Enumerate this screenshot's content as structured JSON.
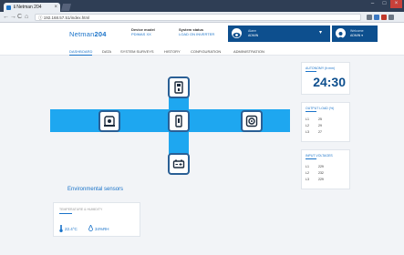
{
  "browser": {
    "tab_title": "ℹ Netman 204",
    "tab_close": "×",
    "url": "ⓘ 192.168.57.51/index.html",
    "nav": {
      "back": "←",
      "forward": "→",
      "reload": "C",
      "home": "⌂"
    },
    "window": {
      "minimize": "–",
      "maximize": "□",
      "close": "×"
    }
  },
  "header": {
    "logo_prefix": "Netman",
    "logo_suffix": "204",
    "device_model_label": "Device model",
    "device_model_value": "PDIMAS XX",
    "system_status_label": "System status",
    "system_status_value": "LOAD ON INVERTER",
    "user_name": "ADMIN",
    "user_caption": "Alarm",
    "welcome_label": "Welcome",
    "welcome_user": "ADMIN ▾",
    "caret": "▾"
  },
  "menu": [
    "DASHBOARD",
    "DATA",
    "SYSTEM SURVEYS",
    "HISTORY",
    "CONFIGURATION",
    "ADMINISTRATION"
  ],
  "cards": {
    "autonomy": {
      "title": "AUTONOMY (h:mm)",
      "value": "24:30"
    },
    "output": {
      "title": "OUTPUT LOAD (%)",
      "rows": [
        [
          "L1",
          "25"
        ],
        [
          "L2",
          "29"
        ],
        [
          "L3",
          "27"
        ]
      ]
    },
    "input": {
      "title": "INPUT VOLTAGES",
      "rows": [
        [
          "L1",
          "229"
        ],
        [
          "L2",
          "232"
        ],
        [
          "L3",
          "229"
        ]
      ]
    }
  },
  "environment": {
    "title": "Environmental sensors",
    "card_title": "TEMPERATURE & HUMIDITY",
    "temperature": "22.4°C",
    "humidity": "34%RH"
  },
  "colors": {
    "accent": "#1a73c9",
    "flow": "#1ea7f0",
    "header": "#0d4f8e"
  }
}
